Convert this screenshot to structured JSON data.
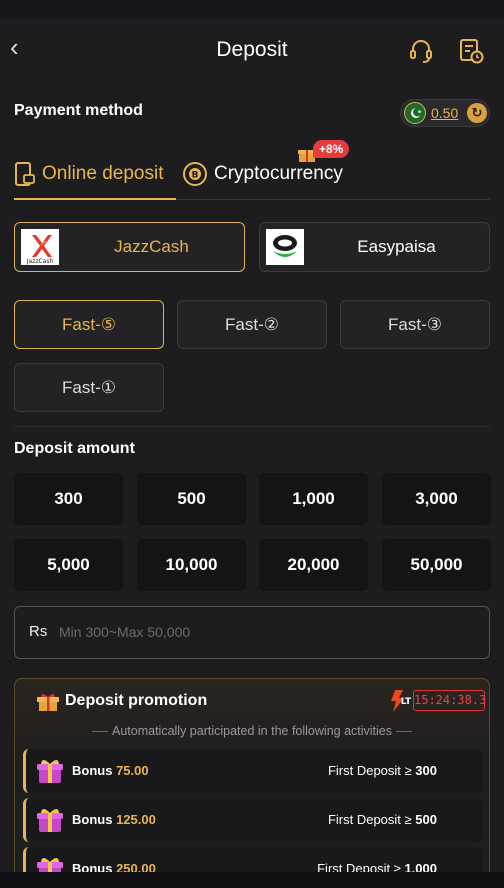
{
  "header": {
    "title": "Deposit"
  },
  "payment": {
    "label": "Payment method",
    "balance": "0.50"
  },
  "tabs": [
    {
      "label": "Online deposit"
    },
    {
      "label": "Cryptocurrency",
      "badge": "+8%"
    }
  ],
  "channels": [
    {
      "label": "JazzCash",
      "logo_text": "JazzCash"
    },
    {
      "label": "Easypaisa"
    }
  ],
  "fast_options": [
    {
      "label": "Fast-⑤"
    },
    {
      "label": "Fast-②"
    },
    {
      "label": "Fast-③"
    },
    {
      "label": "Fast-①"
    }
  ],
  "deposit": {
    "label": "Deposit amount",
    "amounts": [
      "300",
      "500",
      "1,000",
      "3,000",
      "5,000",
      "10,000",
      "20,000",
      "50,000"
    ],
    "currency": "Rs",
    "placeholder": "Min 300~Max 50,000"
  },
  "promotion": {
    "title": "Deposit promotion",
    "lt_label": "LT",
    "timer": "15:24:38.3",
    "subtitle": "Automatically participated in the following activities",
    "items": [
      {
        "bonus_label": "Bonus",
        "bonus_value": "75.00",
        "condition_label": "First Deposit ≥",
        "condition_value": "300"
      },
      {
        "bonus_label": "Bonus",
        "bonus_value": "125.00",
        "condition_label": "First Deposit ≥",
        "condition_value": "500"
      },
      {
        "bonus_label": "Bonus",
        "bonus_value": "250.00",
        "condition_label": "First Deposit ≥",
        "condition_value": "1,000"
      }
    ]
  },
  "colors": {
    "accent": "#e8b64c",
    "background": "#1d1d1f",
    "badge_red": "#e53b3b"
  }
}
